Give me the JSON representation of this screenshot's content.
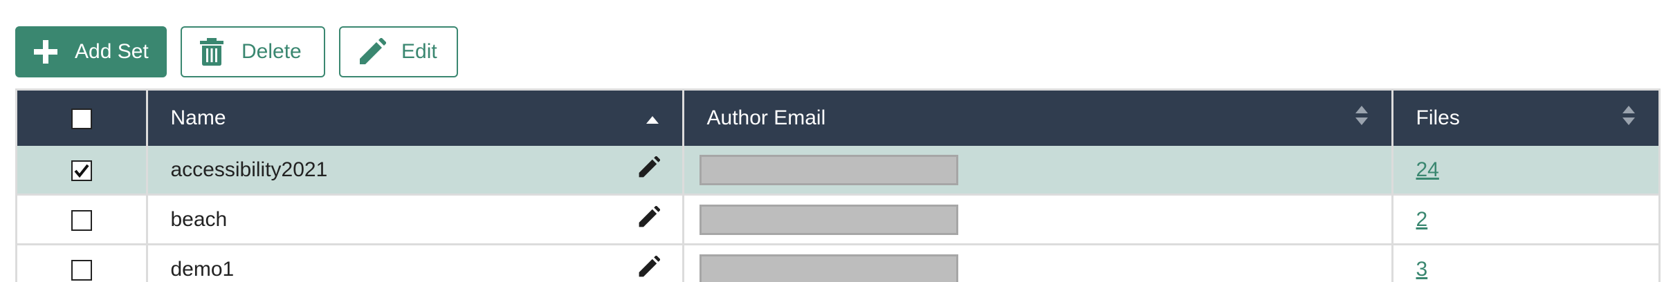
{
  "toolbar": {
    "add_label": "Add Set",
    "delete_label": "Delete",
    "edit_label": "Edit"
  },
  "table": {
    "columns": {
      "name": "Name",
      "email": "Author Email",
      "files": "Files"
    },
    "sort": {
      "column": "name",
      "direction": "ascending"
    },
    "rows": [
      {
        "name": "accessibility2021",
        "email": "",
        "files": "24",
        "checked": true
      },
      {
        "name": "beach",
        "email": "",
        "files": "2",
        "checked": false
      },
      {
        "name": "demo1",
        "email": "",
        "files": "3",
        "checked": false
      }
    ]
  },
  "colors": {
    "accent": "#3a8770",
    "header_bg": "#303d4f",
    "selected_row_bg": "#c8dcd8",
    "redacted": "#bdbdbd"
  },
  "icons": {
    "add": "plus-icon",
    "delete": "trash-icon",
    "edit": "pencil-icon",
    "sort_active": "caret-up-icon",
    "sort_inactive": "sort-icon",
    "checkbox_checked": "checkmark-icon"
  }
}
